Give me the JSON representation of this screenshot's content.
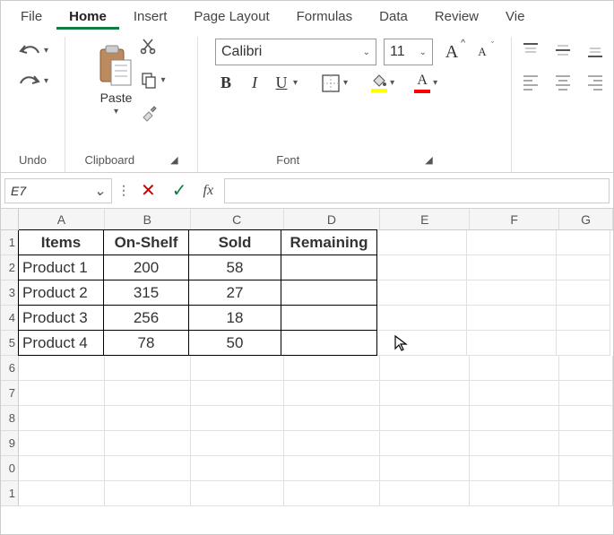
{
  "tabs": {
    "file": "File",
    "home": "Home",
    "insert": "Insert",
    "page_layout": "Page Layout",
    "formulas": "Formulas",
    "data": "Data",
    "review": "Review",
    "view": "Vie"
  },
  "ribbon": {
    "undo_label": "Undo",
    "clipboard_label": "Clipboard",
    "font_label": "Font",
    "paste_label": "Paste",
    "font_name": "Calibri",
    "font_size": "11",
    "bold": "B",
    "italic": "I",
    "underline": "U",
    "font_color_a": "A",
    "inc_A": "A",
    "dec_A": "A"
  },
  "formula_bar": {
    "cell_ref": "E7",
    "fx": "fx",
    "formula": ""
  },
  "columns": [
    "A",
    "B",
    "C",
    "D",
    "E",
    "F",
    "G"
  ],
  "row_numbers": [
    "1",
    "2",
    "3",
    "4",
    "5",
    "6",
    "7",
    "8",
    "9",
    "0",
    "1"
  ],
  "table": {
    "headers": {
      "items": "Items",
      "onshelf": "On-Shelf",
      "sold": "Sold",
      "remaining": "Remaining"
    },
    "rows": [
      {
        "item": "Product 1",
        "onshelf": "200",
        "sold": "58",
        "remaining": ""
      },
      {
        "item": "Product 2",
        "onshelf": "315",
        "sold": "27",
        "remaining": ""
      },
      {
        "item": "Product 3",
        "onshelf": "256",
        "sold": "18",
        "remaining": ""
      },
      {
        "item": "Product 4",
        "onshelf": "78",
        "sold": "50",
        "remaining": ""
      }
    ]
  }
}
